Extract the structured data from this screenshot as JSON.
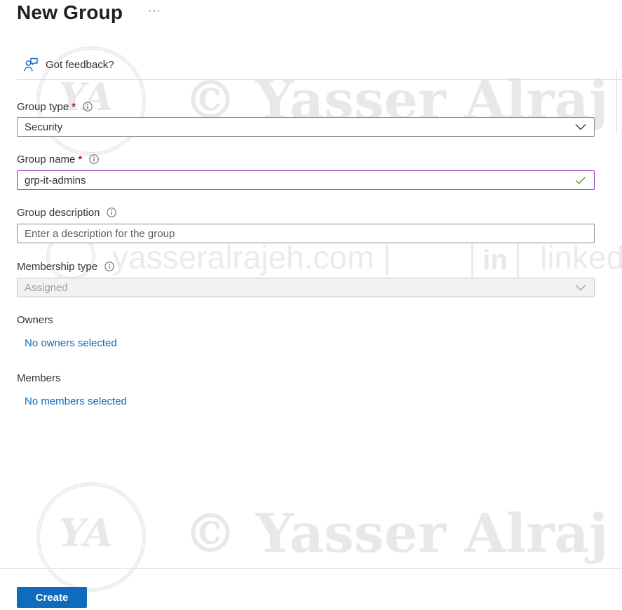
{
  "header": {
    "title": "New Group",
    "more_label": "···"
  },
  "feedback": {
    "label": "Got feedback?"
  },
  "form": {
    "group_type": {
      "label": "Group type",
      "required": "*",
      "value": "Security"
    },
    "group_name": {
      "label": "Group name",
      "required": "*",
      "value": "grp-it-admins"
    },
    "group_description": {
      "label": "Group description",
      "placeholder": "Enter a description for the group"
    },
    "membership_type": {
      "label": "Membership type",
      "value": "Assigned"
    },
    "owners": {
      "label": "Owners",
      "link": "No owners selected"
    },
    "members": {
      "label": "Members",
      "link": "No members selected"
    }
  },
  "footer": {
    "create_label": "Create"
  },
  "watermark": {
    "copyright_text": "©  Yasser Alraj",
    "initials": "YA",
    "site_text": "yasseralrajeh.com  |",
    "linkedin_glyph": "in",
    "linkedin_text": "linked"
  },
  "colors": {
    "accent": "#0f6cbd",
    "required": "#a4262c",
    "focus_border": "#8c2fb8",
    "valid_check": "#5ba02a"
  },
  "icons": {
    "feedback": "person-feedback-icon",
    "info": "info-icon",
    "dropdown": "chevron-down-icon",
    "valid": "checkmark-icon"
  }
}
